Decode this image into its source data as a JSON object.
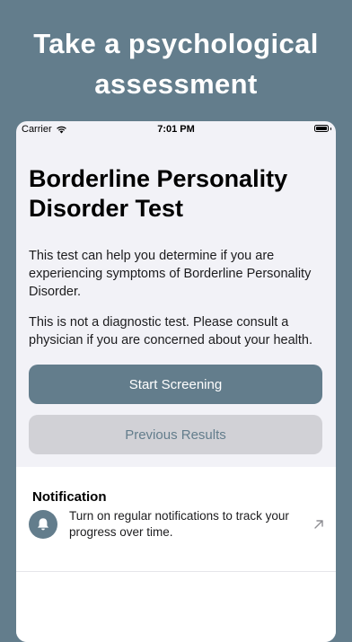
{
  "promo": {
    "line1": "Take a psychological",
    "line2": "assessment"
  },
  "status_bar": {
    "carrier": "Carrier",
    "time": "7:01 PM",
    "wifi_icon": "wifi-icon",
    "battery_icon": "battery-icon",
    "battery_level": 1.0
  },
  "test": {
    "title": "Borderline Personality Disorder Test",
    "description": "This test can help you determine if you are experiencing symptoms of Borderline Personality Disorder.",
    "disclaimer": "This is not a diagnostic test. Please consult a physician if you are concerned about your health."
  },
  "actions": {
    "start_label": "Start Screening",
    "previous_label": "Previous Results"
  },
  "notification": {
    "header": "Notification",
    "text": "Turn on regular notifications to track your progress over time.",
    "icon": "bell-icon",
    "action_icon": "arrow-up-right-icon"
  },
  "colors": {
    "accent": "#637d8c",
    "background": "#f2f2f7",
    "disabled_button": "#d1d1d6"
  }
}
